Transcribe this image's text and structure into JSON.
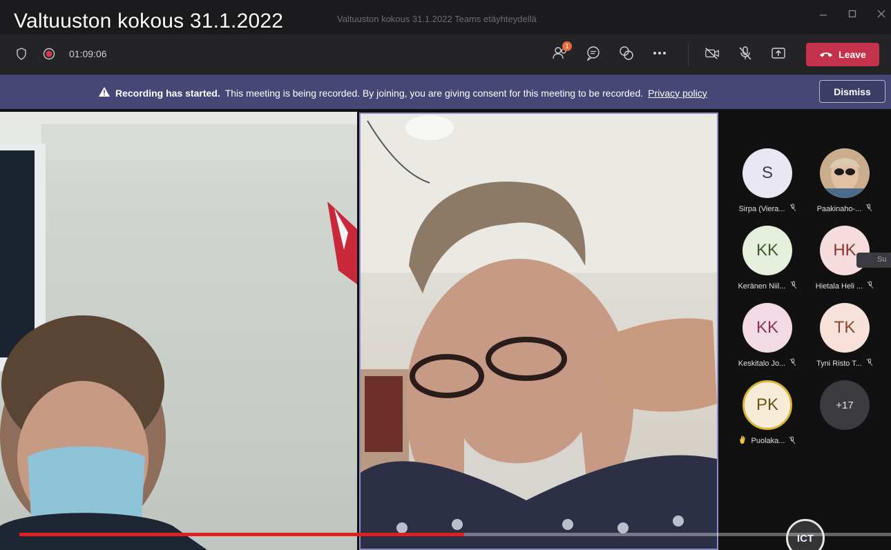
{
  "video_title": "Valtuuston kokous 31.1.2022",
  "window": {
    "title": "Valtuuston kokous 31.1.2022 Teams etäyhteydellä",
    "controls": [
      {
        "icon": "minimize-icon"
      },
      {
        "icon": "maximize-icon"
      },
      {
        "icon": "close-icon"
      }
    ]
  },
  "toolbar": {
    "timer": "01:09:06",
    "participants_badge": "1",
    "leave_label": "Leave"
  },
  "banner": {
    "bold": "Recording has started.",
    "message": "This meeting is being recorded. By joining, you are giving consent for this meeting to be recorded.",
    "link": "Privacy policy",
    "dismiss_label": "Dismiss"
  },
  "roster": {
    "participants": [
      {
        "initials": "S",
        "name": "Sirpa (Viera...",
        "color": "#e9e7f4",
        "text_color": "#3b3b55"
      },
      {
        "initials": "",
        "name": "Paakinaho-...",
        "color": "#8b7a66",
        "photo": true
      },
      {
        "initials": "KK",
        "name": "Keränen Niil...",
        "color": "#e6efdc",
        "text_color": "#3d5a2e"
      },
      {
        "initials": "HK",
        "name": "Hietala Heli ...",
        "color": "#f6dcdc",
        "text_color": "#8a3434"
      },
      {
        "initials": "KK",
        "name": "Keskitalo Jo...",
        "color": "#f3dbe6",
        "text_color": "#8a3557"
      },
      {
        "initials": "TK",
        "name": "Tyni Risto T...",
        "color": "#f7e1d8",
        "text_color": "#8a4630"
      },
      {
        "initials": "PK",
        "name": "Puolaka...",
        "color": "#f6ecd7",
        "text_color": "#6a5318",
        "hand_raised": true
      }
    ],
    "overflow_label": "+17"
  },
  "side_tab_text": "Su",
  "progress": {
    "fraction": 0.51
  },
  "logo_text": "ICT"
}
